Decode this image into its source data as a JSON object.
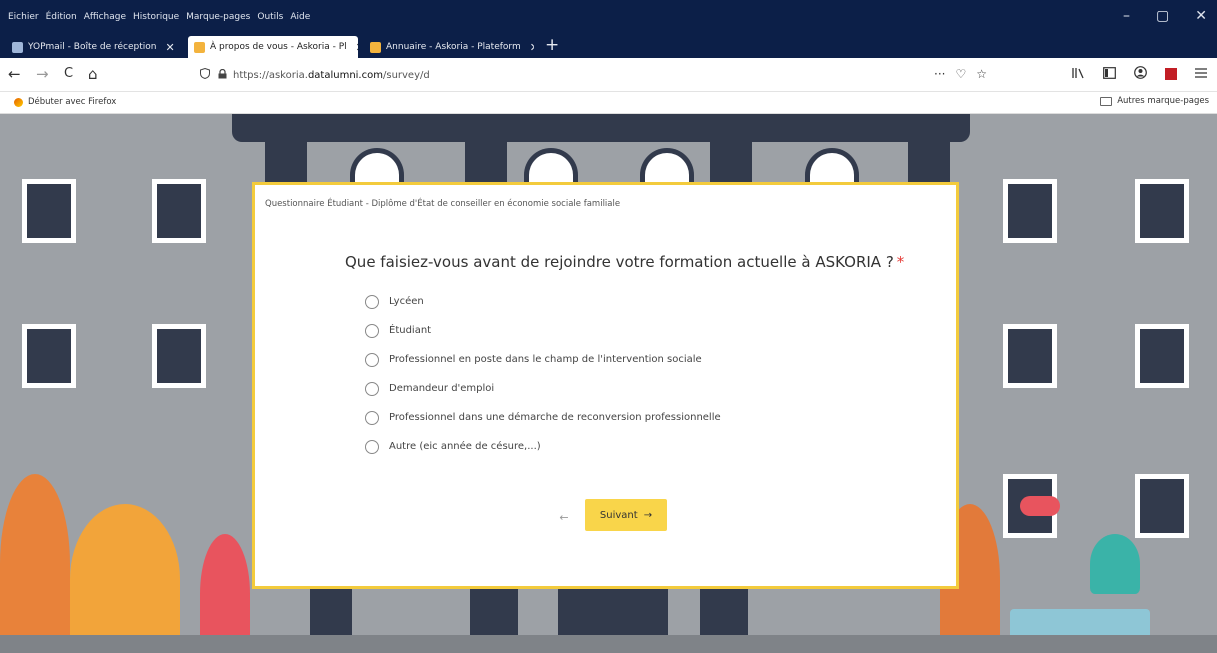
{
  "menu": [
    "Eichier",
    "Édition",
    "Affichage",
    "Historique",
    "Marque-pages",
    "Outils",
    "Aide"
  ],
  "window_controls": [
    "–",
    "▢",
    "✕"
  ],
  "tabs": [
    {
      "label": "YOPmail - Boîte de réception",
      "close": "✕",
      "favicon_color": "#9fb6d9"
    },
    {
      "label": "À propos de vous - Askoria - Pl",
      "close": "✕",
      "favicon_color": "#f3b33d"
    },
    {
      "label": "Annuaire - Askoria - Plateform",
      "close": "✕",
      "favicon_color": "#f3b33d"
    }
  ],
  "new_tab": "+",
  "nav": {
    "back": "←",
    "forward": "→",
    "reload": "C",
    "home": "⌂"
  },
  "url": {
    "prefix": "https://askoria.",
    "host": "datalumni.com",
    "path": "/survey/d"
  },
  "url_actions": [
    "···",
    "♡",
    "☆"
  ],
  "toolbar_icons": [
    "library-icon",
    "sidebar-icon",
    "account-icon",
    "pdf-icon",
    "menu-icon"
  ],
  "bookmarks": {
    "left": "Débuter avec Firefox",
    "right": "Autres marque-pages"
  },
  "survey": {
    "header": "Questionnaire Étudiant - Diplôme d'État de conseiller en économie sociale familiale",
    "question": "Que faisiez-vous avant de rejoindre votre formation actuelle à ASKORIA ?",
    "required_mark": "*",
    "options": [
      "Lycéen",
      "Étudiant",
      "Professionnel en poste dans le champ de l'intervention sociale",
      "Demandeur d'emploi",
      "Professionnel dans une démarche de reconversion professionnelle",
      "Autre (eic année de césure,...)"
    ],
    "back_label": "←",
    "next_label": "Suivant",
    "next_arrow": "→"
  },
  "colors": {
    "accent": "#f9d54a",
    "card_border": "#f3cb3c",
    "building": "#323a4c",
    "background": "#9da1a6",
    "required": "#e53935"
  }
}
